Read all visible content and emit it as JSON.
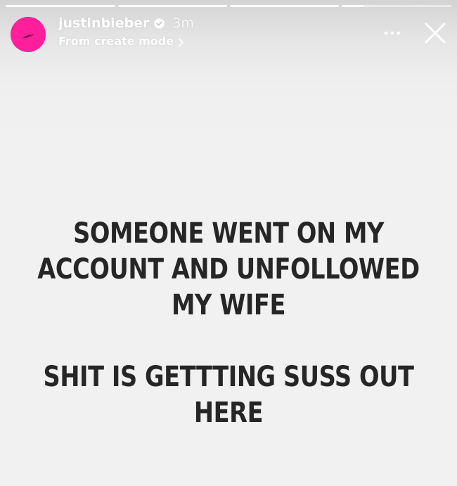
{
  "story": {
    "progress_segments": [
      {
        "fill": 1.0
      },
      {
        "fill": 1.0
      },
      {
        "fill": 1.0
      },
      {
        "fill": 0.2
      }
    ],
    "header": {
      "username": "justinbieber",
      "verified_icon": "verified-badge-icon",
      "time": "3m",
      "source_label": "From create mode",
      "source_chevron_icon": "chevron-right-icon",
      "more_icon": "more-options-icon",
      "close_icon": "close-icon",
      "avatar_color": "#ff1e9c"
    },
    "text": {
      "paragraph_1": [
        "SOMEONE WENT ON MY",
        "ACCOUNT AND UNFOLLOWED",
        "MY WIFE"
      ],
      "paragraph_2": [
        "SHIT IS GETTTING SUSS OUT",
        "HERE"
      ]
    },
    "colors": {
      "background": "#f1f1f1",
      "text": "#262626",
      "header_text": "#ffffff"
    }
  }
}
